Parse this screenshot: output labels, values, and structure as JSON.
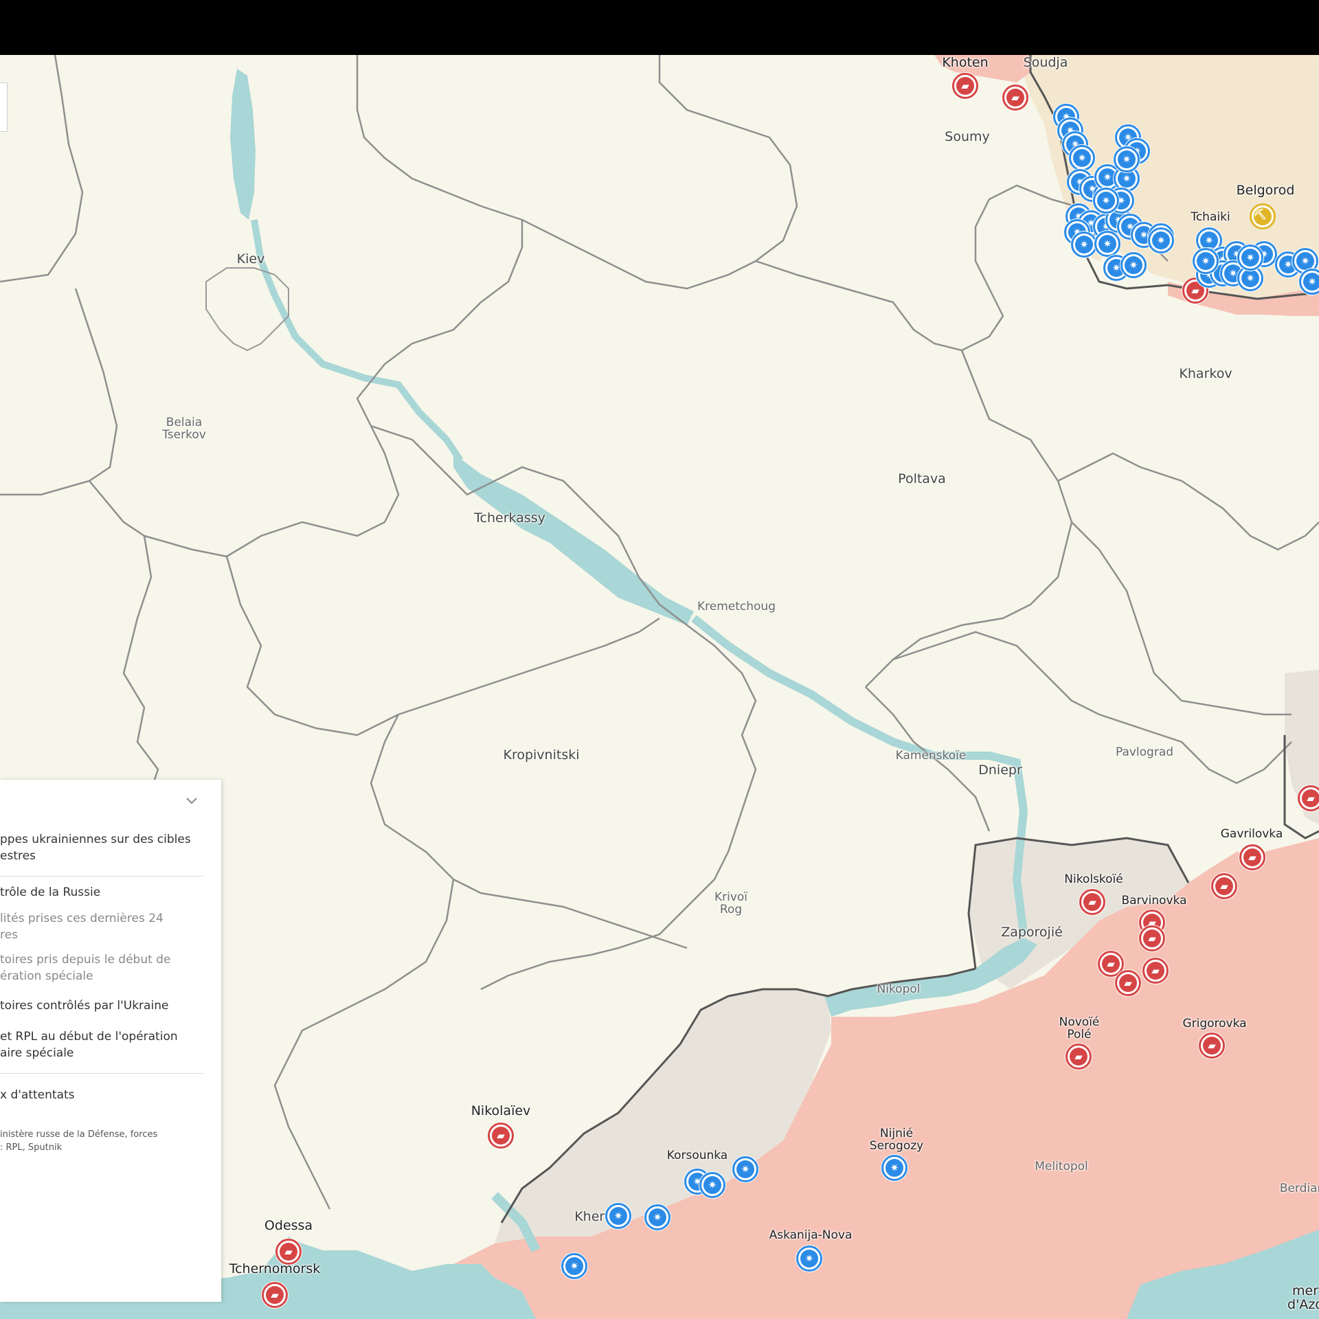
{
  "cities": {
    "khoten": "Khoten",
    "soudja": "Soudja",
    "soumy": "Soumy",
    "belgorod": "Belgorod",
    "tchaiki": "Tchaiki",
    "kiev": "Kiev",
    "kharkov": "Kharkov",
    "belaia_tserkov": "Belaia\nTserkov",
    "poltava": "Poltava",
    "tcherkassy": "Tcherkassy",
    "kremetchoug": "Kremetchoug",
    "kropivnitski": "Kropivnitski",
    "kamenskoie": "Kamenskoïe",
    "dniepr": "Dniepr",
    "pavlograd": "Pavlograd",
    "gavrilovka": "Gavrilovka",
    "nikolskoie": "Nikolskoïé",
    "barvinovka": "Barvinovka",
    "zaporojie": "Zaporojié",
    "krivoi_rog": "Krivoï\nRog",
    "nikopol": "Nikopol",
    "novoie_pole": "Novoïé\nPolé",
    "grigorovka": "Grigorovka",
    "nikolaiev": "Nikolaïev",
    "nijnie_serogozy": "Nijnié\nSerogozy",
    "korsounka": "Korsounka",
    "kherson": "Kherson",
    "melitopol": "Melitopol",
    "berdiansk": "Berdians",
    "askania_nova": "Askanija-Nova",
    "odessa": "Odessa",
    "tchernomorsk": "Tchernomorsk",
    "mer_azov": "mer\nd'Azo"
  },
  "legend": {
    "item_strikes": "ppes ukrainiennes sur des cibles\nestres",
    "item_russia_control": "trôle de la Russie",
    "item_last24": "lités prises ces dernières 24\nres",
    "item_since_start": "toires pris depuis le début de\nération spéciale",
    "item_ukraine_control": "toires contrôlés par l'Ukraine",
    "item_rpl": "et RPL au début de l'opération\naire spéciale",
    "item_attacks": "x d'attentats",
    "source": "inistère russe de la Défense, forces\n: RPL, Sputnik"
  },
  "colors": {
    "land": "#f7f6ea",
    "water": "#a9d6d6",
    "russia_control": "#f6c2b6",
    "taken_since_start": "#e8e3da",
    "russia_territory": "#f3e7cf",
    "marker_red": "#d64545",
    "marker_blue": "#2b8be6",
    "marker_yellow": "#e0b628"
  },
  "icons": {
    "red_marker": "truck-icon",
    "blue_marker": "explosion-icon",
    "yellow_marker": "pickaxe-icon",
    "chevron": "chevron-down-icon"
  }
}
